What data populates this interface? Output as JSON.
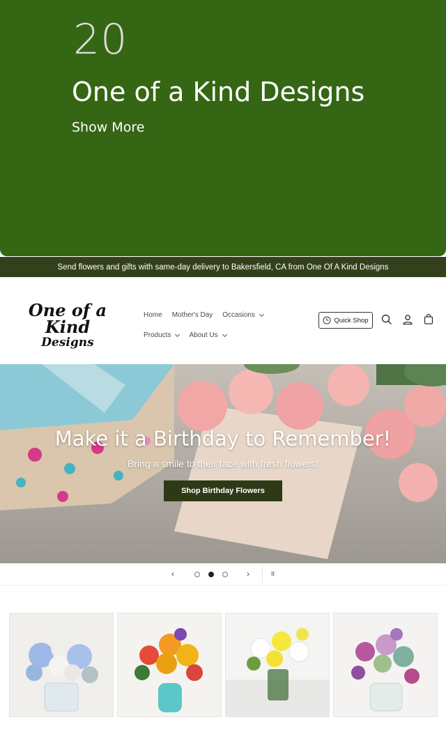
{
  "promo": {
    "count": "20",
    "title": "One of a Kind Designs",
    "show_more": "Show More"
  },
  "announcement": "Send flowers and gifts with same-day delivery to Bakersfield, CA from One Of A Kind Designs",
  "header": {
    "logo_line1": "One of a Kind",
    "logo_line2": "Designs",
    "nav": {
      "row1": [
        {
          "label": "Home",
          "dropdown": false
        },
        {
          "label": "Mother's Day",
          "dropdown": false
        },
        {
          "label": "Occasions",
          "dropdown": true
        }
      ],
      "row2": [
        {
          "label": "Products",
          "dropdown": true
        },
        {
          "label": "About Us",
          "dropdown": true
        }
      ]
    },
    "quick_shop": "Quick Shop",
    "icons": [
      "clock-icon",
      "search-icon",
      "account-icon",
      "cart-icon"
    ]
  },
  "hero": {
    "title": "Make it a Birthday to Remember!",
    "subtitle": "Bring a smile to their face with fresh flowers!",
    "button": "Shop Birthday Flowers",
    "slide_count": 3,
    "active_slide": 2
  },
  "slider": {
    "prev": "‹",
    "next": "›",
    "pause": "II"
  },
  "colors": {
    "promo_bg": "#346614",
    "announce_bg": "#34401c",
    "button_bg": "#2e3a16"
  },
  "products": [
    {
      "image": "blue-white-bouquet"
    },
    {
      "image": "sunflower-orange-bouquet"
    },
    {
      "image": "yellow-white-daisy-bouquet"
    },
    {
      "image": "purple-rose-succulent-bouquet"
    }
  ]
}
